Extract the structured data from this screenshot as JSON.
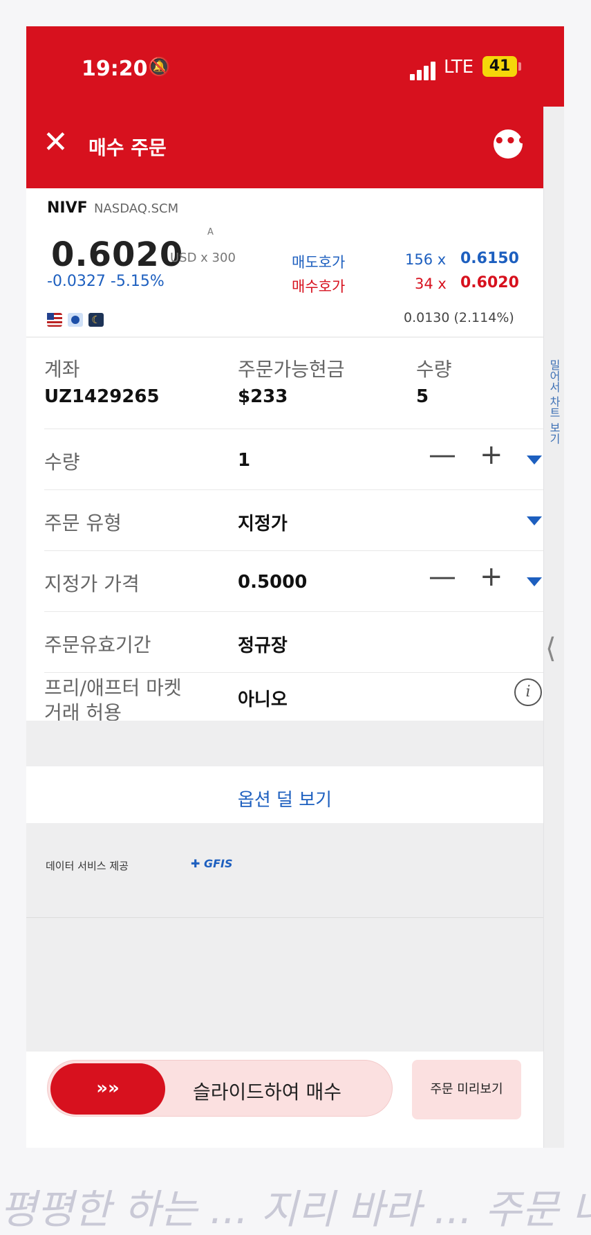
{
  "status_bar": {
    "time": "19:20",
    "network": "LTE",
    "battery": "41"
  },
  "header": {
    "title": "매수 주문"
  },
  "side_panel": {
    "label": "밀어서 차트 보기"
  },
  "quote": {
    "symbol": "NIVF",
    "exchange": "NASDAQ.SCM",
    "marker": "A",
    "price": "0.6020",
    "unit": "USD x 300",
    "change": "-0.0327",
    "change_pct": "-5.15%",
    "ask_label": "매도호가",
    "bid_label": "매수호가",
    "ask_size": "156 x",
    "bid_size": "34 x",
    "ask_price": "0.6150",
    "bid_price": "0.6020",
    "spread": "0.0130 (2.114%)"
  },
  "account": {
    "account_label": "계좌",
    "account_value": "UZ1429265",
    "cash_label": "주문가능현금",
    "cash_value": "$233",
    "qty_label": "수량",
    "qty_value": "5"
  },
  "form": {
    "quantity_label": "수량",
    "quantity_value": "1",
    "order_type_label": "주문 유형",
    "order_type_value": "지정가",
    "limit_price_label": "지정가 가격",
    "limit_price_value": "0.5000",
    "validity_label": "주문유효기간",
    "validity_value": "정규장",
    "extended_label_1": "프리/애프터 마켓",
    "extended_label_2": "거래 허용",
    "extended_value": "아니오"
  },
  "fewer_options": "옵션 덜 보기",
  "provider": {
    "text": "데이터 서비스 제공",
    "brand": "GFIS"
  },
  "bottom": {
    "slide_label": "슬라이드하여 매수",
    "slide_arrows": "»»",
    "preview_label": "주문 미리보기"
  },
  "background_caption": "평평한 하는 ... 지리 바라 ... 주문 너머"
}
